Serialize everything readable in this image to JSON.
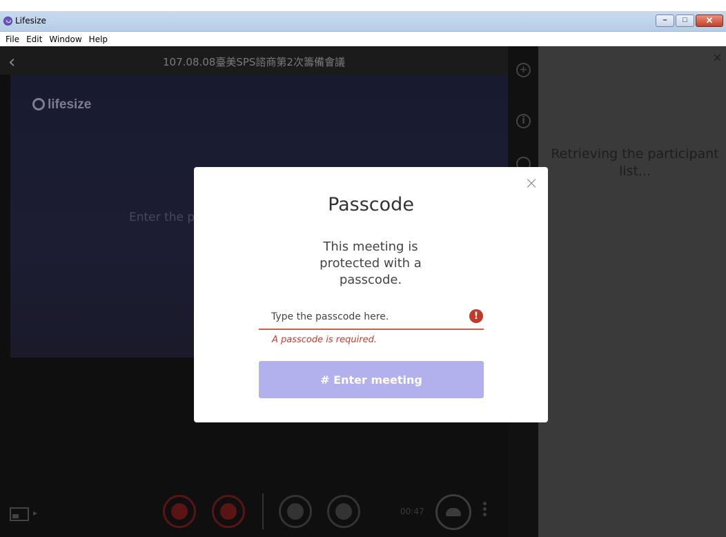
{
  "window": {
    "title": "Lifesize",
    "minimize_glyph": "–",
    "maximize_glyph": "□",
    "close_glyph": "✕"
  },
  "menubar": {
    "items": [
      "File",
      "Edit",
      "Window",
      "Help"
    ]
  },
  "call": {
    "back_glyph": "‹",
    "meeting_title": "107.08.08臺美SPS諮商第2次籌備會議",
    "brand_text": "lifesize",
    "background_prompt": "Enter the p",
    "timer": "00:47"
  },
  "side_icons": [
    "add-icon",
    "info-icon",
    "participants-icon"
  ],
  "right_panel": {
    "close_glyph": "×",
    "status_text": "Retrieving the participant list..."
  },
  "modal": {
    "close_glyph": "×",
    "title": "Passcode",
    "description": "This meeting is protected with a passcode.",
    "input_placeholder": "Type the passcode here.",
    "input_value": "",
    "error_icon_glyph": "!",
    "error_message": "A passcode is required.",
    "enter_button_label": "# Enter meeting"
  },
  "colors": {
    "accent_button": "#b3b0ee",
    "error": "#d0372b"
  }
}
